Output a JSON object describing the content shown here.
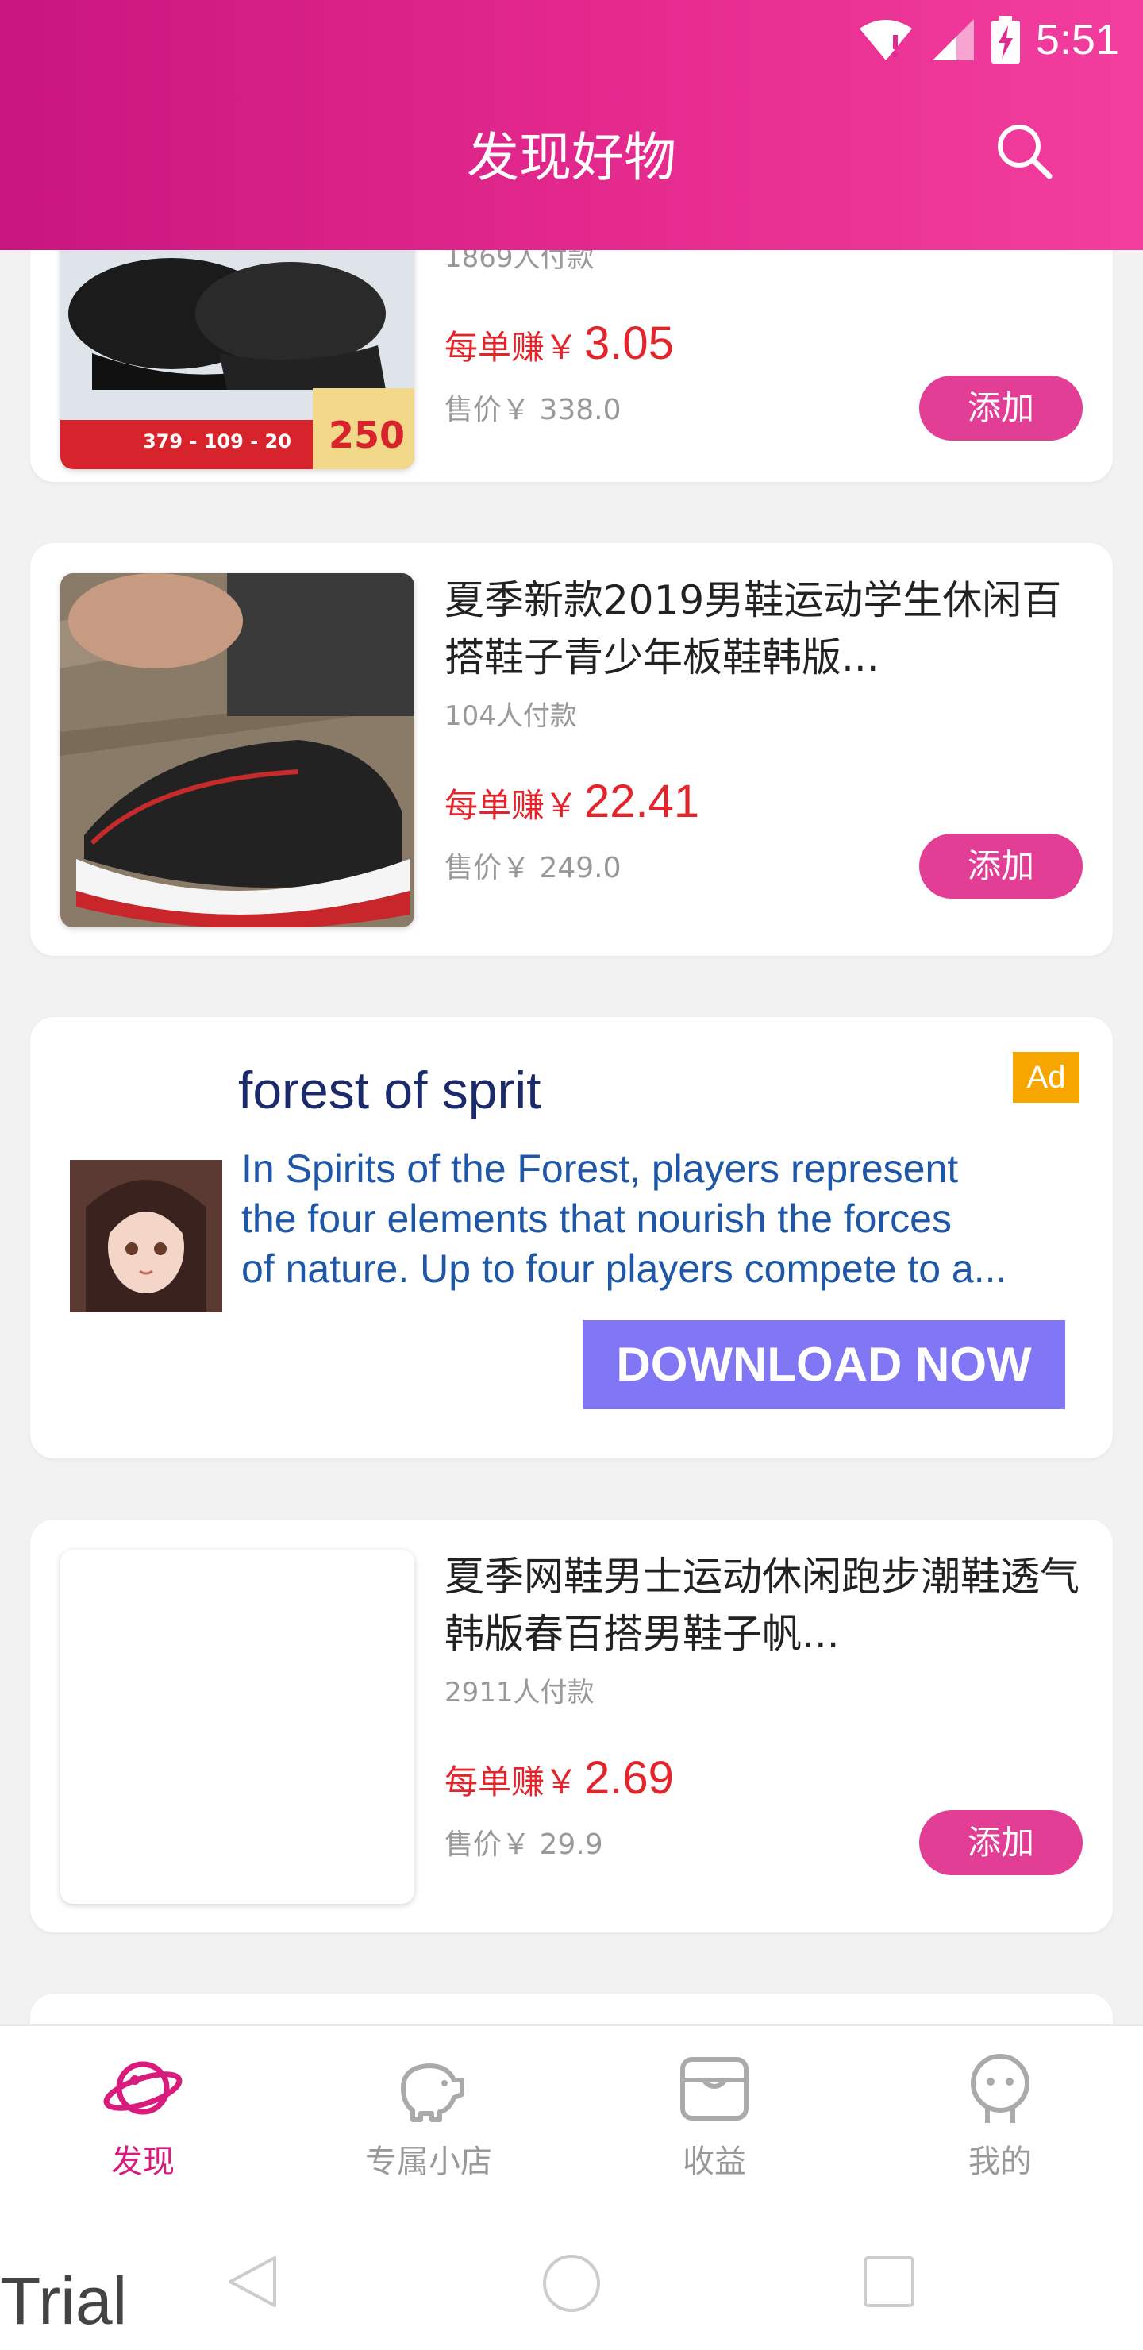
{
  "status_bar": {
    "time": "5:51"
  },
  "header": {
    "title": "发现好物"
  },
  "products": [
    {
      "buyers": "1869人付款",
      "earn_label": "每单赚￥",
      "earn_value": "3.05",
      "price": "售价￥ 338.0",
      "add_label": "添加",
      "thumb_text": [
        "379 - 109 - 20",
        "250"
      ]
    },
    {
      "title": "夏季新款2019男鞋运动学生休闲百搭鞋子青少年板鞋韩版...",
      "buyers": "104人付款",
      "earn_label": "每单赚￥",
      "earn_value": "22.41",
      "price": "售价￥ 249.0",
      "add_label": "添加"
    },
    {
      "title": "夏季网鞋男士运动休闲跑步潮鞋透气韩版春百搭男鞋子帆...",
      "buyers": "2911人付款",
      "earn_label": "每单赚￥",
      "earn_value": "2.69",
      "price": "售价￥ 29.9",
      "add_label": "添加"
    }
  ],
  "ad": {
    "title": "forest of sprit",
    "badge": "Ad",
    "desc_lines": [
      "In Spirits of the Forest, players represent",
      "the four elements that nourish the forces",
      "of nature. Up to four players compete to a..."
    ],
    "cta": "DOWNLOAD NOW"
  },
  "tabs": [
    {
      "label": "发现",
      "icon": "planet-icon",
      "active": true
    },
    {
      "label": "专属小店",
      "icon": "piggy-bank-icon",
      "active": false
    },
    {
      "label": "收益",
      "icon": "box-icon",
      "active": false
    },
    {
      "label": "我的",
      "icon": "user-icon",
      "active": false
    }
  ],
  "watermark": "Trial",
  "colors": {
    "accent": "#e23e96",
    "header_start": "#c9157f",
    "header_end": "#f23e9f",
    "earn": "#e4242b",
    "ad_button": "#8177f5",
    "ad_badge": "#f7a600"
  }
}
